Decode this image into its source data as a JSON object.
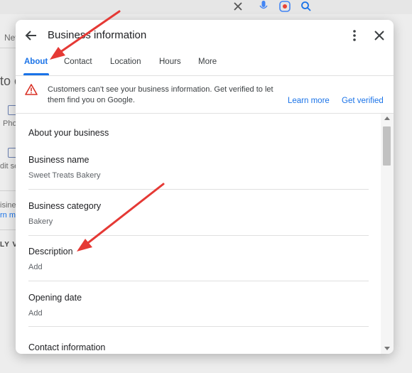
{
  "background": {
    "tab_fragment": "Nev",
    "heading_fragment": "to c",
    "item1_fragment": "Pho",
    "item2_fragment": "dit se",
    "item3_fragment": "isines",
    "item4_fragment": "rn mo",
    "item5_fragment": "LY V"
  },
  "dialog": {
    "title": "Business information",
    "back_icon": "arrow-left-icon",
    "more_icon": "more-vert-icon",
    "close_icon": "close-icon"
  },
  "tabs": [
    {
      "label": "About",
      "active": true
    },
    {
      "label": "Contact",
      "active": false
    },
    {
      "label": "Location",
      "active": false
    },
    {
      "label": "Hours",
      "active": false
    },
    {
      "label": "More",
      "active": false
    }
  ],
  "banner": {
    "icon": "warning-icon",
    "message": "Customers can't see your business information. Get verified to let them find you on Google.",
    "learn_more": "Learn more",
    "get_verified": "Get verified"
  },
  "sections": {
    "about_heading": "About your business",
    "contact_heading": "Contact information"
  },
  "fields": [
    {
      "label": "Business name",
      "value": "Sweet Treats Bakery"
    },
    {
      "label": "Business category",
      "value": "Bakery"
    },
    {
      "label": "Description",
      "value": "Add"
    },
    {
      "label": "Opening date",
      "value": "Add"
    }
  ],
  "colors": {
    "accent": "#1a73e8",
    "warning": "#d93025",
    "annotation_arrow": "#e53935"
  }
}
